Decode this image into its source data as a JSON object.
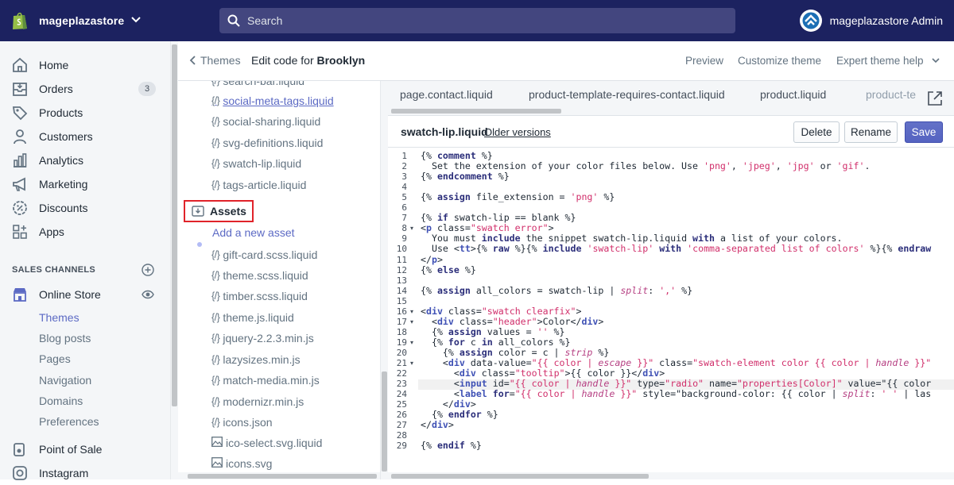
{
  "topbar": {
    "store_name": "mageplazastore",
    "search_placeholder": "Search",
    "account_name": "mageplazastore Admin"
  },
  "sidebar": {
    "items": [
      {
        "label": "Home",
        "icon": "home-icon"
      },
      {
        "label": "Orders",
        "icon": "orders-icon",
        "badge": "3"
      },
      {
        "label": "Products",
        "icon": "tag-icon"
      },
      {
        "label": "Customers",
        "icon": "person-icon"
      },
      {
        "label": "Analytics",
        "icon": "bar-chart-icon"
      },
      {
        "label": "Marketing",
        "icon": "megaphone-icon"
      },
      {
        "label": "Discounts",
        "icon": "discount-icon"
      },
      {
        "label": "Apps",
        "icon": "apps-icon"
      }
    ],
    "sales_channels_title": "SALES CHANNELS",
    "online_store": "Online Store",
    "sub_items": [
      "Themes",
      "Blog posts",
      "Pages",
      "Navigation",
      "Domains",
      "Preferences"
    ],
    "point_of_sale": "Point of Sale",
    "instagram": "Instagram"
  },
  "header": {
    "back_label": "Themes",
    "edit_prefix": "Edit code for",
    "theme_name": "Brooklyn",
    "links": [
      "Preview",
      "Customize theme",
      "Expert theme help"
    ]
  },
  "tree": {
    "snippets": [
      "search-bar.liquid",
      "social-meta-tags.liquid",
      "social-sharing.liquid",
      "svg-definitions.liquid",
      "swatch-lip.liquid",
      "tags-article.liquid"
    ],
    "assets_label": "Assets",
    "add_asset": "Add a new asset",
    "assets": [
      "gift-card.scss.liquid",
      "theme.scss.liquid",
      "timber.scss.liquid",
      "theme.js.liquid",
      "jquery-2.2.3.min.js",
      "lazysizes.min.js",
      "match-media.min.js",
      "modernizr.min.js",
      "icons.json",
      "ico-select.svg.liquid",
      "icons.svg"
    ]
  },
  "tabs": [
    "page.contact.liquid",
    "product-template-requires-contact.liquid",
    "product.liquid",
    "product-te"
  ],
  "file": {
    "name": "swatch-lip.liquid",
    "older_versions": "Older versions",
    "delete": "Delete",
    "rename": "Rename",
    "save": "Save"
  },
  "code": {
    "line_numbers": [
      "1",
      "2",
      "3",
      "4",
      "5",
      "6",
      "7",
      "8",
      "9",
      "10",
      "11",
      "12",
      "13",
      "14",
      "15",
      "16",
      "17",
      "18",
      "19",
      "20",
      "21",
      "22",
      "23",
      "24",
      "25",
      "26",
      "27",
      "28",
      "29"
    ],
    "lines": [
      "{% comment %}",
      "  Set the extension of your color files below. Use 'png', 'jpeg', 'jpg' or 'gif'.",
      "{% endcomment %}",
      "",
      "{% assign file_extension = 'png' %}",
      "",
      "{% if swatch-lip == blank %}",
      "<p class=\"swatch error\">",
      "  You must include the snippet swatch-lip.liquid with a list of your colors.",
      "  Use <tt>{% raw %}{% include 'swatch-lip' with 'comma-separated list of colors' %}{% endraw",
      "</p>",
      "{% else %}",
      "",
      "{% assign all_colors = swatch-lip | split: ',' %}",
      "",
      "<div class=\"swatch clearfix\">",
      "  <div class=\"header\">Color</div>",
      "  {% assign values = '' %}",
      "  {% for c in all_colors %}",
      "    {% assign color = c | strip %}",
      "    <div data-value=\"{{ color | escape }}\" class=\"swatch-element color {{ color | handle }}\"",
      "      <div class=\"tooltip\">{{ color }}</div>",
      "      <input id=\"{{ color | handle }}\" type=\"radio\" name=\"properties[Color]\" value=\"{{ color",
      "      <label for=\"{{ color | handle }}\" style=\"background-color: {{ color | split: ' ' | las",
      "    </div>",
      "  {% endfor %}",
      "</div>",
      "",
      "{% endif %}"
    ]
  },
  "colors": {
    "topbar": "#1c2260",
    "accent": "#5c6ac4",
    "highlight_border": "#e0232a"
  }
}
